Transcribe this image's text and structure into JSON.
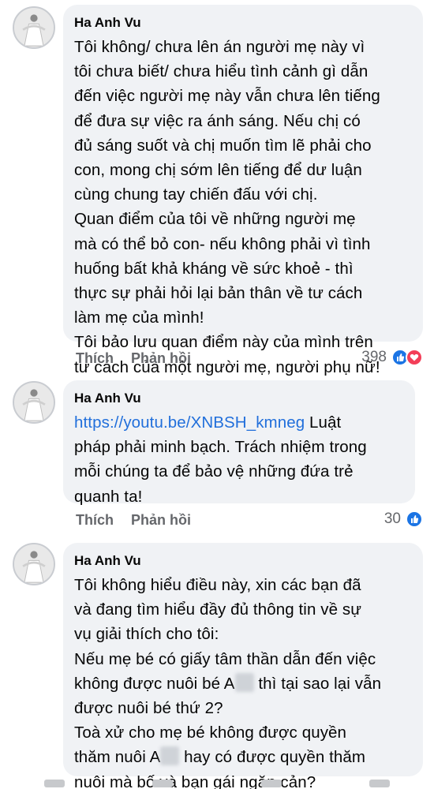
{
  "comments": [
    {
      "author": "Ha Anh Vu",
      "text": "Tôi không/ chưa lên án người mẹ này vì\ntôi chưa biết/ chưa hiểu tình cảnh gì dẫn\nđến việc người mẹ này vẫn chưa lên tiếng\nđể đưa sự việc ra ánh sáng. Nếu chị có\nđủ sáng suốt và chị muốn tìm lẽ phải cho\ncon, mong chị sớm lên tiếng để dư luận\ncùng chung tay chiến đấu với chị.\nQuan điểm của tôi về những người mẹ\nmà có thể bỏ con- nếu không phải vì tình\nhuống bất khả kháng về sức khoẻ - thì\nthực sự phải hỏi lại bản thân về tư cách\nlàm mẹ của mình!\nTôi bảo lưu quan điểm này của mình trên\ntư cách của một người mẹ, người phụ nữ!",
      "like_label": "Thích",
      "reply_label": "Phản hồi",
      "reaction_count": "398",
      "reactions": [
        "like-icon",
        "love-icon"
      ]
    },
    {
      "author": "Ha Anh Vu",
      "link": "https://youtu.be/XNBSH_kmneg",
      "text_after_link": " Luật\npháp phải minh bạch. Trách nhiệm trong\nmỗi chúng ta để bảo vệ những đứa trẻ\nquanh ta!",
      "like_label": "Thích",
      "reply_label": "Phản hồi",
      "reaction_count": "30",
      "reactions": [
        "like-icon"
      ]
    },
    {
      "author": "Ha Anh Vu",
      "text_part1": "Tôi không hiểu điều này, xin các bạn đã\nvà đang tìm hiểu đầy đủ thông tin về sự\nvụ giải thích cho tôi:\nNếu mẹ bé có giấy tâm thần dẫn đến việc\nkhông được nuôi bé A",
      "text_part2": " thì tại sao lại vẫn\nđược nuôi bé thứ 2?\nToà xử cho mẹ bé không được quyền\nthăm nuôi A",
      "text_part3": " hay có được quyền thăm\nnuôi mà bố và bạn gái ngăn cản?"
    }
  ],
  "colors": {
    "bubble": "#f0f2f5",
    "link": "#216fdb",
    "like": "#1b74e4",
    "love": "#f33e58",
    "meta": "#65676b"
  }
}
